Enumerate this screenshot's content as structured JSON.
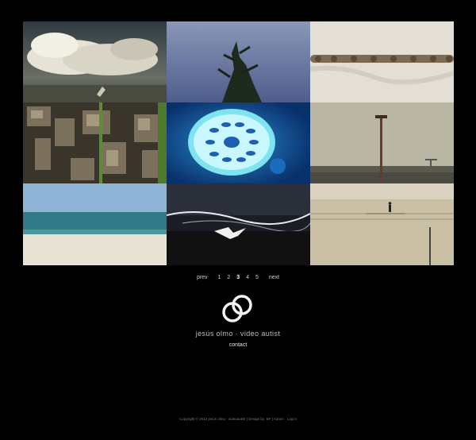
{
  "gallery": {
    "tiles": [
      {
        "name": "cloud-bird-thumbnail"
      },
      {
        "name": "tree-sky-thumbnail"
      },
      {
        "name": "caterpillars-sand-thumbnail"
      },
      {
        "name": "ruins-aerial-thumbnail"
      },
      {
        "name": "glowing-shell-thumbnail"
      },
      {
        "name": "tower-field-thumbnail"
      },
      {
        "name": "sea-beach-thumbnail"
      },
      {
        "name": "bird-water-thumbnail"
      },
      {
        "name": "beach-walker-thumbnail"
      }
    ]
  },
  "pagination": {
    "prev": "prev",
    "pages": [
      "1",
      "2",
      "3",
      "4",
      "5"
    ],
    "current": "3",
    "next": "next"
  },
  "brand": {
    "title": "jesús olmo · video autist",
    "logo_icon": "linked-rings-icon"
  },
  "nav": {
    "contact": "contact"
  },
  "footer": {
    "text": "Copyright © 2013 jesús olmo · videoautist | Design by: BF | Admin · Log in"
  },
  "colors": {
    "background": "#000000",
    "text": "#cccccc"
  }
}
